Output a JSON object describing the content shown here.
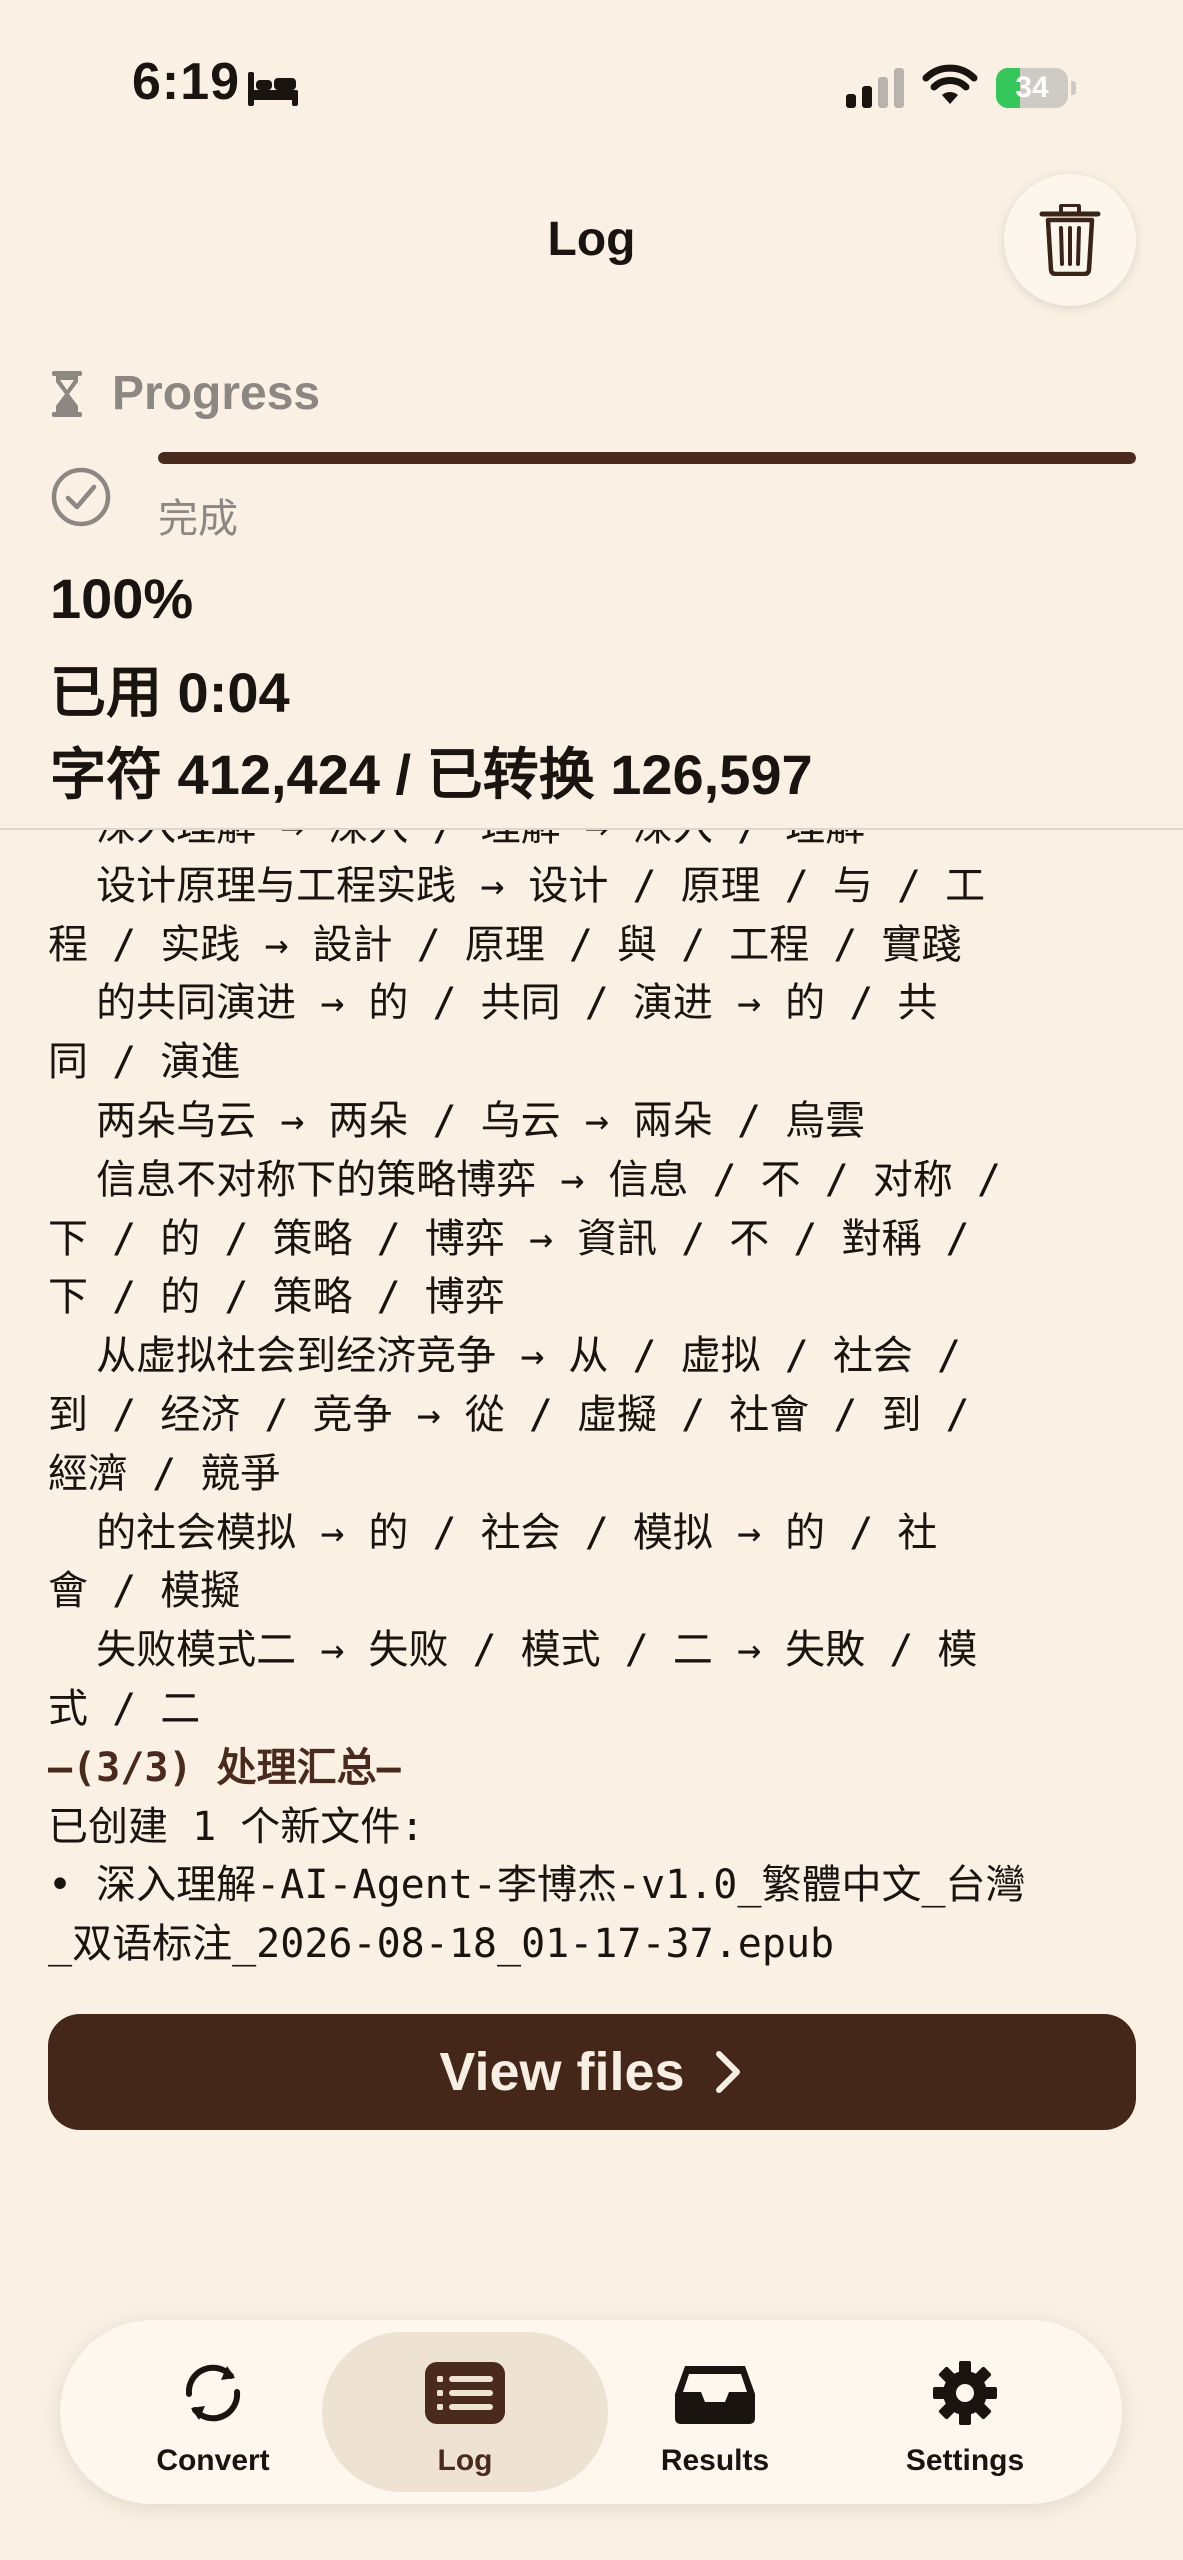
{
  "status_bar": {
    "time": "6:19",
    "battery_level": "34",
    "battery_fraction": 0.34,
    "icons": [
      "bed-icon",
      "cellular-signal-icon",
      "wifi-icon",
      "battery-charging-icon"
    ]
  },
  "header": {
    "title": "Log",
    "trash_icon": "trash-icon"
  },
  "progress": {
    "label": "Progress",
    "value_fraction": 1.0,
    "status": "完成",
    "percent": "100%",
    "elapsed": "已用 0:04",
    "chars": "字符 412,424 / 已转换 126,597"
  },
  "log": {
    "lines": [
      "  深入理解 → 深入 / 理解 → 深入 / 理解",
      "  设计原理与工程实践 → 设计 / 原理 / 与 / 工",
      "程 / 实践 → 設計 / 原理 / 與 / 工程 / 實踐",
      "  的共同演进 → 的 / 共同 / 演进 → 的 / 共",
      "同 / 演進",
      "  两朵乌云 → 两朵 / 乌云 → 兩朵 / 烏雲",
      "  信息不对称下的策略博弈 → 信息 / 不 / 对称 /",
      "下 / 的 / 策略 / 博弈 → 資訊 / 不 / 對稱 /",
      "下 / 的 / 策略 / 博弈",
      "  从虚拟社会到经济竞争 → 从 / 虚拟 / 社会 /",
      "到 / 经济 / 竞争 → 從 / 虛擬 / 社會 / 到 /",
      "經濟 / 競爭",
      "  的社会模拟 → 的 / 社会 / 模拟 → 的 / 社",
      "會 / 模擬",
      "  失败模式二 → 失败 / 模式 / 二 → 失敗 / 模",
      "式 / 二",
      "—(3/3) 处理汇总—",
      "已创建 1 个新文件:",
      "• 深入理解-AI-Agent-李博杰-v1.0_繁體中文_台灣",
      "_双语标注_2026-08-18_01-17-37.epub"
    ],
    "heading_index": 16
  },
  "actions": {
    "view_files_label": "View files"
  },
  "tabs": [
    {
      "label": "Convert",
      "icon": "convert-icon",
      "active": false
    },
    {
      "label": "Log",
      "icon": "log-list-icon",
      "active": true
    },
    {
      "label": "Results",
      "icon": "inbox-tray-icon",
      "active": false
    },
    {
      "label": "Settings",
      "icon": "gear-icon",
      "active": false
    }
  ],
  "colors": {
    "background": "#faf0e3",
    "accent": "#452719",
    "progress_track": "#e4d7c7",
    "secondary_text": "#8c8783",
    "battery_green": "#35c759"
  }
}
